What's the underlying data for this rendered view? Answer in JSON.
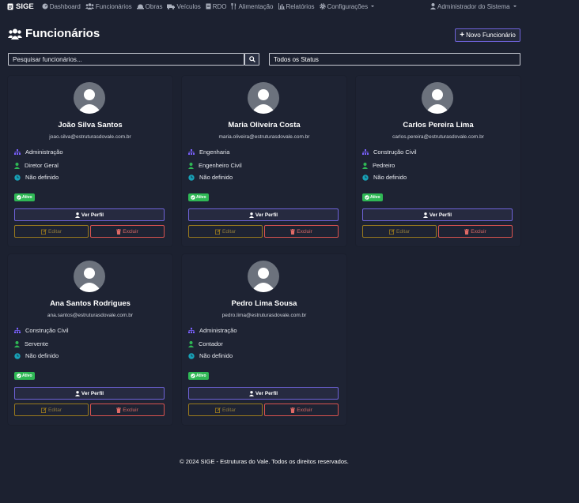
{
  "navbar": {
    "brand": "SIGE",
    "items": [
      {
        "label": "Dashboard",
        "icon": "dashboard-icon"
      },
      {
        "label": "Funcionários",
        "icon": "users-icon"
      },
      {
        "label": "Obras",
        "icon": "hardhat-icon"
      },
      {
        "label": "Veículos",
        "icon": "truck-icon"
      },
      {
        "label": "RDO",
        "icon": "document-icon"
      },
      {
        "label": "Alimentação",
        "icon": "utensils-icon"
      },
      {
        "label": "Relatórios",
        "icon": "chart-icon"
      },
      {
        "label": "Configurações",
        "icon": "gear-icon"
      }
    ],
    "user": "Administrador do Sistema"
  },
  "header": {
    "title": "Funcionários",
    "new_button": "Novo Funcionário"
  },
  "filters": {
    "search_placeholder": "Pesquisar funcionários...",
    "status_selected": "Todos os Status"
  },
  "employees": [
    {
      "name": "João Silva Santos",
      "email": "joao.silva@estruturasdovale.com.br",
      "department": "Administração",
      "role": "Diretor Geral",
      "schedule": "Não definido",
      "status": "Ativo"
    },
    {
      "name": "Maria Oliveira Costa",
      "email": "maria.oliveira@estruturasdovale.com.br",
      "department": "Engenharia",
      "role": "Engenheiro Civil",
      "schedule": "Não definido",
      "status": "Ativo"
    },
    {
      "name": "Carlos Pereira Lima",
      "email": "carlos.pereira@estruturasdovale.com.br",
      "department": "Construção Civil",
      "role": "Pedreiro",
      "schedule": "Não definido",
      "status": "Ativo"
    },
    {
      "name": "Ana Santos Rodrigues",
      "email": "ana.santos@estruturasdovale.com.br",
      "department": "Construção Civil",
      "role": "Servente",
      "schedule": "Não definido",
      "status": "Ativo"
    },
    {
      "name": "Pedro Lima Sousa",
      "email": "pedro.lima@estruturasdovale.com.br",
      "department": "Administração",
      "role": "Contador",
      "schedule": "Não definido",
      "status": "Ativo"
    }
  ],
  "card_actions": {
    "view": "Ver Perfil",
    "edit": "Editar",
    "delete": "Excluir"
  },
  "footer": "© 2024 SIGE - Estruturas do Vale. Todos os direitos reservados.",
  "colors": {
    "background": "#1c2130",
    "primary": "#6f63d9",
    "warning": "#9a7a1d",
    "danger": "#d9534f",
    "success": "#2fb855",
    "department_icon": "#7b61ff",
    "role_icon": "#2fb855",
    "schedule_icon": "#17a2b8"
  }
}
